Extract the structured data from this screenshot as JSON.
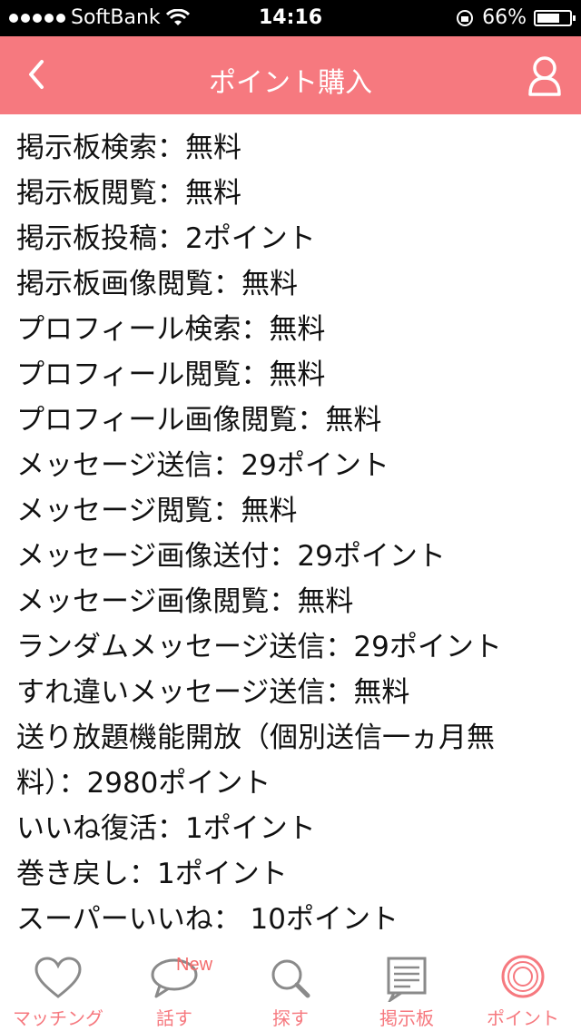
{
  "status_bar": {
    "carrier": "SoftBank",
    "time": "14:16",
    "battery": "66%"
  },
  "nav": {
    "title": "ポイント購入"
  },
  "items": [
    "掲示板検索：無料",
    "掲示板閲覧：無料",
    "掲示板投稿：2ポイント",
    "掲示板画像閲覧：無料",
    "プロフィール検索：無料",
    "プロフィール閲覧：無料",
    "プロフィール画像閲覧：無料",
    "メッセージ送信：29ポイント",
    "メッセージ閲覧：無料",
    "メッセージ画像送付：29ポイント",
    "メッセージ画像閲覧：無料",
    "ランダムメッセージ送信：29ポイント",
    "すれ違いメッセージ送信：無料",
    "送り放題機能開放（個別送信一ヵ月無料）：2980ポイント",
    "いいね復活：1ポイント",
    "巻き戻し：1ポイント",
    "スーパーいいね： 10ポイント"
  ],
  "tabs": {
    "matching": "マッチング",
    "talk": "話す",
    "talk_badge": "New",
    "search": "探す",
    "board": "掲示板",
    "points": "ポイント"
  },
  "colors": {
    "accent": "#f6797f",
    "tab_icon_gray": "#8a8a8a"
  }
}
